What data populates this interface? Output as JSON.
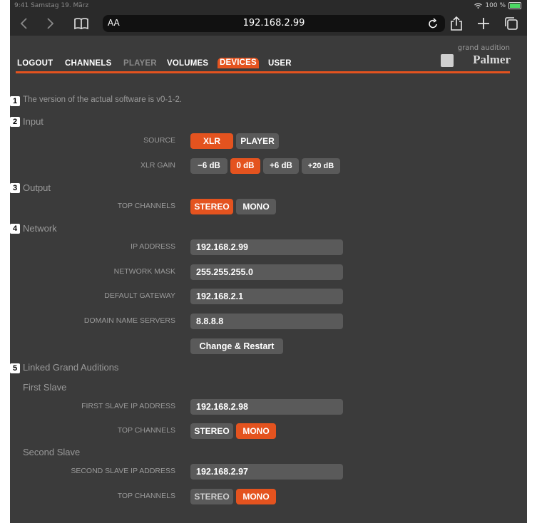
{
  "status_bar": {
    "left_text": "9:41  Samstag 19. März",
    "battery": "100 %"
  },
  "browser": {
    "url": "192.168.2.99",
    "aa_label": "AA"
  },
  "nav": {
    "items": [
      "LOGOUT",
      "CHANNELS",
      "PLAYER",
      "VOLUMES",
      "DEVICES",
      "USER"
    ],
    "active": "DEVICES",
    "disabled": [
      "PLAYER"
    ],
    "accent_color": "#e4531f"
  },
  "brand": {
    "small": "grand audition",
    "big": "Palmer"
  },
  "sections": {
    "s1": {
      "num": "1",
      "text": "The version of the actual software is v0-1-2."
    },
    "s2": {
      "num": "2",
      "title": "Input",
      "source_label": "SOURCE",
      "source_options": [
        "XLR",
        "PLAYER"
      ],
      "source_selected": "XLR",
      "gain_label": "XLR GAIN",
      "gain_options": [
        "−6 dB",
        "0 dB",
        "+6 dB",
        "+20 dB"
      ],
      "gain_selected": "0 dB"
    },
    "s3": {
      "num": "3",
      "title": "Output",
      "top_label": "TOP CHANNELS",
      "top_options": [
        "STEREO",
        "MONO"
      ],
      "top_selected": "STEREO"
    },
    "s4": {
      "num": "4",
      "title": "Network",
      "ip_label": "IP ADDRESS",
      "ip": "192.168.2.99",
      "mask_label": "NETWORK MASK",
      "mask": "255.255.255.0",
      "gw_label": "DEFAULT GATEWAY",
      "gw": "192.168.2.1",
      "dns_label": "DOMAIN NAME SERVERS",
      "dns": "8.8.8.8",
      "apply": "Change & Restart"
    },
    "s5": {
      "num": "5",
      "title": "Linked Grand Auditions",
      "first": {
        "title": "First Slave",
        "ip_label": "FIRST SLAVE IP ADDRESS",
        "ip": "192.168.2.98",
        "top_label": "TOP CHANNELS",
        "top_options": [
          "STEREO",
          "MONO"
        ],
        "top_selected": "MONO"
      },
      "second": {
        "title": "Second Slave",
        "ip_label": "SECOND SLAVE IP ADDRESS",
        "ip": "192.168.2.97",
        "top_label": "TOP CHANNELS",
        "top_options": [
          "STEREO",
          "MONO"
        ],
        "top_selected": "MONO"
      }
    }
  }
}
